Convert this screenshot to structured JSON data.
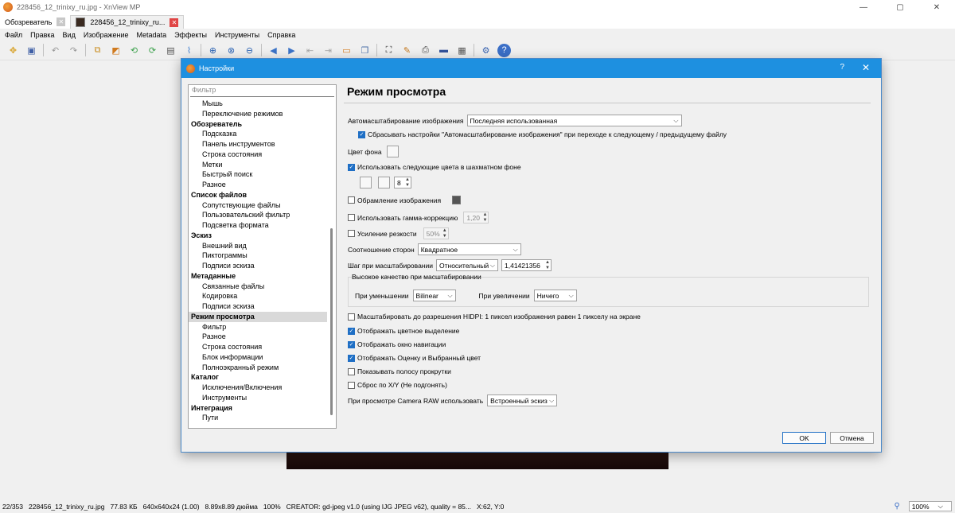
{
  "window": {
    "title": "228456_12_trinixy_ru.jpg - XnView MP",
    "min": "—",
    "max": "▢",
    "close": "✕"
  },
  "tabs": [
    {
      "label": "Обозреватель"
    },
    {
      "label": "228456_12_trinixy_ru..."
    }
  ],
  "menu": [
    "Файл",
    "Правка",
    "Вид",
    "Изображение",
    "Metadata",
    "Эффекты",
    "Инструменты",
    "Справка"
  ],
  "toolbar_icons": [
    "browse-icon",
    "save-icon",
    "undo-icon",
    "redo-icon",
    "crop-icon",
    "resize-icon",
    "rotate-left-icon",
    "rotate-right-icon",
    "adjust-icon",
    "chart-icon",
    "zoom-in-icon",
    "zoom-fit-icon",
    "zoom-out-icon",
    "prev-icon",
    "next-icon",
    "first-icon",
    "last-icon",
    "slideshow-icon",
    "copy-icon",
    "fullscreen-icon",
    "pencil-icon",
    "print-icon",
    "scanner-icon",
    "device-icon",
    "settings-icon",
    "help-icon"
  ],
  "dialog": {
    "title": "Настройки",
    "help": "?",
    "close": "✕",
    "filter_placeholder": "Фильтр",
    "tree": [
      {
        "label": "Мышь",
        "level": 1
      },
      {
        "label": "Переключение режимов",
        "level": 1
      },
      {
        "label": "Обозреватель",
        "level": 0
      },
      {
        "label": "Подсказка",
        "level": 1
      },
      {
        "label": "Панель инструментов",
        "level": 1
      },
      {
        "label": "Строка состояния",
        "level": 1
      },
      {
        "label": "Метки",
        "level": 1
      },
      {
        "label": "Быстрый поиск",
        "level": 1
      },
      {
        "label": "Разное",
        "level": 1
      },
      {
        "label": "Список файлов",
        "level": 0
      },
      {
        "label": "Сопутствующие файлы",
        "level": 1
      },
      {
        "label": "Пользовательский фильтр",
        "level": 1
      },
      {
        "label": "Подсветка формата",
        "level": 1
      },
      {
        "label": "Эскиз",
        "level": 0
      },
      {
        "label": "Внешний вид",
        "level": 1
      },
      {
        "label": "Пиктограммы",
        "level": 1
      },
      {
        "label": "Подписи эскиза",
        "level": 1
      },
      {
        "label": "Метаданные",
        "level": 0
      },
      {
        "label": "Связанные файлы",
        "level": 1
      },
      {
        "label": "Кодировка",
        "level": 1
      },
      {
        "label": "Подписи эскиза",
        "level": 1
      },
      {
        "label": "Режим просмотра",
        "level": 0,
        "selected": true
      },
      {
        "label": "Фильтр",
        "level": 1
      },
      {
        "label": "Разное",
        "level": 1
      },
      {
        "label": "Строка состояния",
        "level": 1
      },
      {
        "label": "Блок информации",
        "level": 1
      },
      {
        "label": "Полноэкранный режим",
        "level": 1
      },
      {
        "label": "Каталог",
        "level": 0
      },
      {
        "label": "Исключения/Включения",
        "level": 1
      },
      {
        "label": "Инструменты",
        "level": 1
      },
      {
        "label": "Интеграция",
        "level": 0
      },
      {
        "label": "Пути",
        "level": 1
      }
    ],
    "heading": "Режим просмотра",
    "autoscale_label": "Автомасштабирование изображения",
    "autoscale_value": "Последняя использованная",
    "reset_autoscale": "Сбрасывать настройки \"Автомасштабирование изображения\" при переходе к следующему / предыдущему файлу",
    "bg_color_label": "Цвет фона",
    "checker_label": "Использовать следующие цвета в шахматном фоне",
    "checker_size": "8",
    "frame_label": "Обрамление изображения",
    "gamma_label": "Использовать гамма-коррекцию",
    "gamma_value": "1,20",
    "sharpen_label": "Усиление резкости",
    "sharpen_value": "50%",
    "aspect_label": "Соотношение сторон",
    "aspect_value": "Квадратное",
    "zoomstep_label": "Шаг при масштабировании",
    "zoomstep_mode": "Относительный",
    "zoomstep_value": "1,41421356",
    "hq_group": "Высокое качество при масштабировании",
    "hq_down_label": "При уменьшении",
    "hq_down_value": "Bilinear",
    "hq_up_label": "При увеличении",
    "hq_up_value": "Ничего",
    "hidpi_label": "Масштабировать до разрешения HIDPI: 1 пиксел изображения равен 1 пикселу на экране",
    "colorsel_label": "Отображать цветное выделение",
    "navwin_label": "Отображать окно навигации",
    "rating_label": "Отображать Оценку и Выбранный цвет",
    "scrollbar_label": "Показывать полосу прокрутки",
    "resetxy_label": "Сброс по X/Y (Не подгонять)",
    "raw_label": "При просмотре Camera RAW использовать",
    "raw_value": "Встроенный эскиз",
    "ok": "OK",
    "cancel": "Отмена"
  },
  "status": {
    "index": "22/353",
    "filename": "228456_12_trinixy_ru.jpg",
    "size": "77.83 КБ",
    "dims": "640x640x24 (1.00)",
    "inches": "8.89x8.89 дюйма",
    "zoom_pct": "100%",
    "creator": "CREATOR: gd-jpeg v1.0 (using IJG JPEG v62), quality = 85...",
    "coords": "X:62, Y:0",
    "zoom_select": "100%"
  }
}
